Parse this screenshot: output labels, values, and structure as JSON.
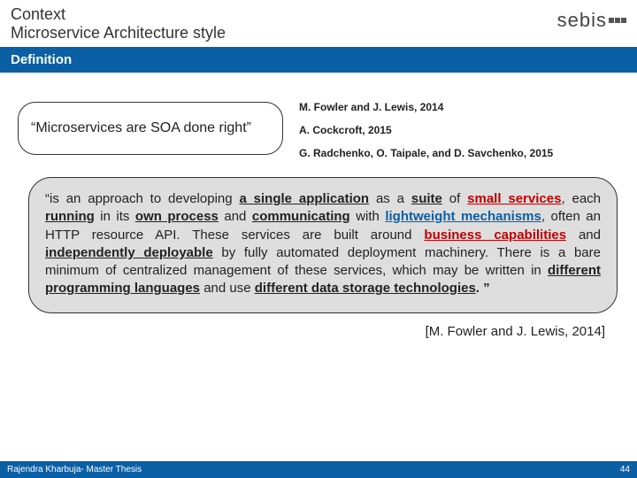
{
  "header": {
    "line1": "Context",
    "line2": "Microservice Architecture style",
    "logo_text": "sebis"
  },
  "definition_label": "Definition",
  "quote_box": "“Microservices are SOA done right”",
  "references": {
    "r1": "M. Fowler and J. Lewis, 2014",
    "r2": "A. Cockcroft, 2015",
    "r3": "G. Radchenko, O. Taipale, and D. Savchenko, 2015"
  },
  "big_quote": {
    "open": "“is an approach to developing ",
    "a_single_app": "a single application",
    "as_suite": " as a ",
    "suite": "suite",
    "of": " of ",
    "small_services": "small services",
    "each": ", each ",
    "running": "running",
    "in_its": " in its ",
    "own_process": "own process",
    "and": " and ",
    "communicating": "communicating",
    "with": " with ",
    "lightweight": "lightweight mechanisms",
    "often_http": ", often an HTTP resource API. These services are built around ",
    "biz_cap": "business capabilities",
    "and2": " and ",
    "indep_deploy": "independently deployable",
    "rest": " by fully automated deployment machinery. There is a bare minimum of centralized management of these services, which may be written in ",
    "diff_lang": "different programming languages",
    "and_use": " and use ",
    "diff_data": "different data storage technologies",
    "close": ". ”"
  },
  "attribution": "[M. Fowler and J. Lewis, 2014]",
  "footer": {
    "left": "Rajendra Kharbuja- Master Thesis",
    "page": "44"
  }
}
